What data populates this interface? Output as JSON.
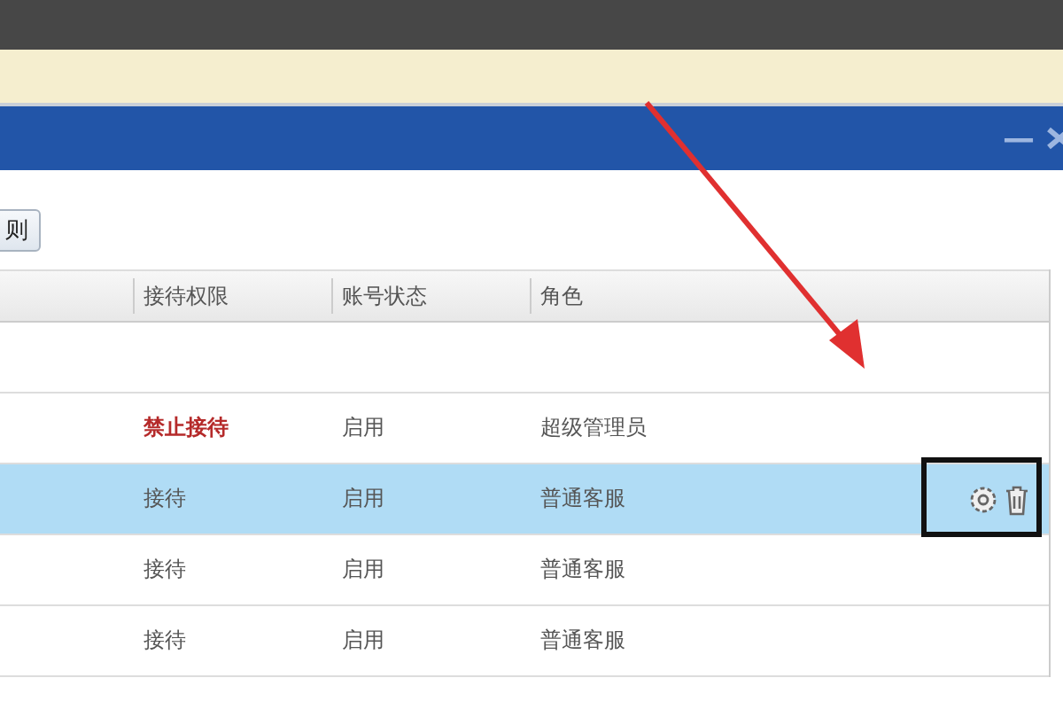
{
  "window": {
    "minimize": "—"
  },
  "toolbar": {
    "button": "则"
  },
  "table": {
    "columns": [
      "接待权限",
      "账号状态",
      "角色"
    ],
    "rows": [
      {
        "selected": false
      },
      {
        "permission": "禁止接待",
        "status": "启用",
        "role": "超级管理员",
        "restricted": true,
        "selected": false,
        "actions": false
      },
      {
        "permission": "接待",
        "status": "启用",
        "role": "普通客服",
        "restricted": false,
        "selected": true,
        "actions": true
      },
      {
        "permission": "接待",
        "status": "启用",
        "role": "普通客服",
        "restricted": false,
        "selected": false,
        "actions": false
      },
      {
        "permission": "接待",
        "status": "启用",
        "role": "普通客服",
        "restricted": false,
        "selected": false,
        "actions": false
      }
    ]
  }
}
